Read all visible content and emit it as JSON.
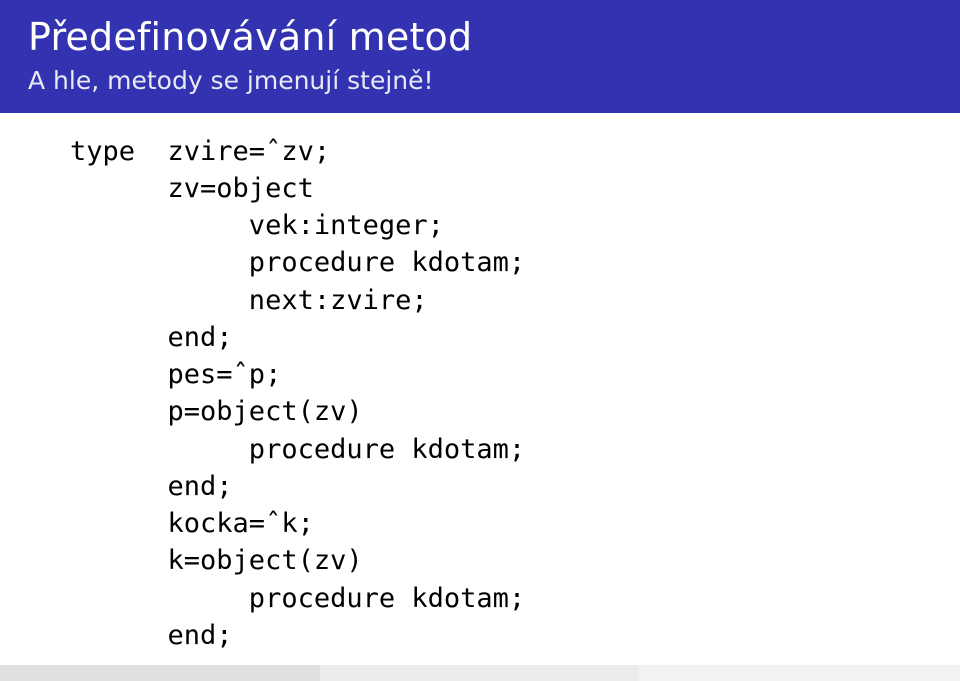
{
  "header": {
    "title": "Předefinovávání metod",
    "subtitle": "A hle, metody se jmenují stejně!"
  },
  "code": {
    "l01": "type  zvire=ˆzv;",
    "l02": "      zv=object",
    "l03": "           vek:integer;",
    "l04": "           procedure kdotam;",
    "l05": "           next:zvire;",
    "l06": "      end;",
    "l07": "      pes=ˆp;",
    "l08": "      p=object(zv)",
    "l09": "           procedure kdotam;",
    "l10": "      end;",
    "l11": "      kocka=ˆk;",
    "l12": "      k=object(zv)",
    "l13": "           procedure kdotam;",
    "l14": "      end;"
  }
}
